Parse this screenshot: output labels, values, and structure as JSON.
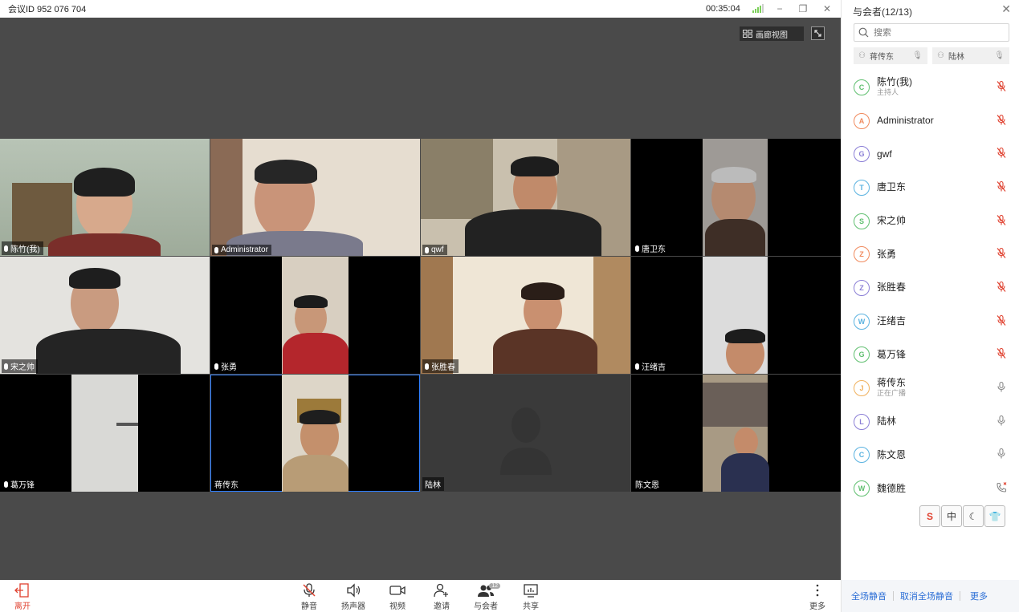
{
  "titlebar": {
    "meeting_id": "会议ID 952 076 704",
    "timer": "00:35:04",
    "minimize": "−",
    "restore": "❐",
    "close": "✕"
  },
  "stage": {
    "gallery_label": "画廊视图",
    "fullscreen_icon": "fullscreen-icon"
  },
  "tiles": [
    {
      "name": "陈竹(我)",
      "mic": true
    },
    {
      "name": "Administrator",
      "mic": true
    },
    {
      "name": "qwf",
      "mic": true
    },
    {
      "name": "唐卫东",
      "mic": true
    },
    {
      "name": "宋之帅",
      "mic": true
    },
    {
      "name": "张勇",
      "mic": true
    },
    {
      "name": "张胜春",
      "mic": true
    },
    {
      "name": "汪绪吉",
      "mic": true
    },
    {
      "name": "葛万锋",
      "mic": true
    },
    {
      "name": "蒋传东",
      "mic": false
    },
    {
      "name": "陆林",
      "mic": false
    },
    {
      "name": "陈文恩",
      "mic": false
    }
  ],
  "toolbar": {
    "leave": "离开",
    "mute": "静音",
    "speaker": "扬声器",
    "video": "视频",
    "invite": "邀请",
    "participants": "与会者",
    "participants_badge": "12",
    "share": "共享",
    "more": "更多"
  },
  "panel": {
    "title": "与会者(12/13)",
    "search_placeholder": "搜索",
    "speaking": [
      "蒋传东",
      "陆林"
    ],
    "participants": [
      {
        "name": "陈竹(我)",
        "sub": "主持人",
        "letter": "C",
        "color": "#5fbf6f",
        "mic": "muted"
      },
      {
        "name": "Administrator",
        "sub": "",
        "letter": "A",
        "color": "#f08a5d",
        "mic": "muted"
      },
      {
        "name": "gwf",
        "sub": "",
        "letter": "G",
        "color": "#8b7fd6",
        "mic": "muted"
      },
      {
        "name": "唐卫东",
        "sub": "",
        "letter": "T",
        "color": "#5ab2e0",
        "mic": "muted"
      },
      {
        "name": "宋之帅",
        "sub": "",
        "letter": "S",
        "color": "#5fbf6f",
        "mic": "muted"
      },
      {
        "name": "张勇",
        "sub": "",
        "letter": "Z",
        "color": "#f08a5d",
        "mic": "muted"
      },
      {
        "name": "张胜春",
        "sub": "",
        "letter": "Z",
        "color": "#8b7fd6",
        "mic": "muted"
      },
      {
        "name": "汪绪吉",
        "sub": "",
        "letter": "W",
        "color": "#5ab2e0",
        "mic": "muted"
      },
      {
        "name": "葛万锋",
        "sub": "",
        "letter": "G",
        "color": "#5fbf6f",
        "mic": "muted"
      },
      {
        "name": "蒋传东",
        "sub": "正在广播",
        "letter": "J",
        "color": "#f0b15d",
        "mic": "on"
      },
      {
        "name": "陆林",
        "sub": "",
        "letter": "L",
        "color": "#8b7fd6",
        "mic": "on"
      },
      {
        "name": "陈文恩",
        "sub": "",
        "letter": "C",
        "color": "#5ab2e0",
        "mic": "on"
      },
      {
        "name": "魏德胜",
        "sub": "",
        "letter": "W",
        "color": "#5fbf6f",
        "mic": "phone"
      }
    ],
    "ime": [
      "S",
      "中",
      "☾",
      "👕"
    ],
    "footer": {
      "mute_all": "全场静音",
      "unmute_all": "取消全场静音",
      "more": "更多"
    }
  },
  "colors": {
    "accent": "#2b6ed6",
    "leave": "#e0412f",
    "stage_bg": "#4a4a4a",
    "muted_red": "#e0412f"
  }
}
